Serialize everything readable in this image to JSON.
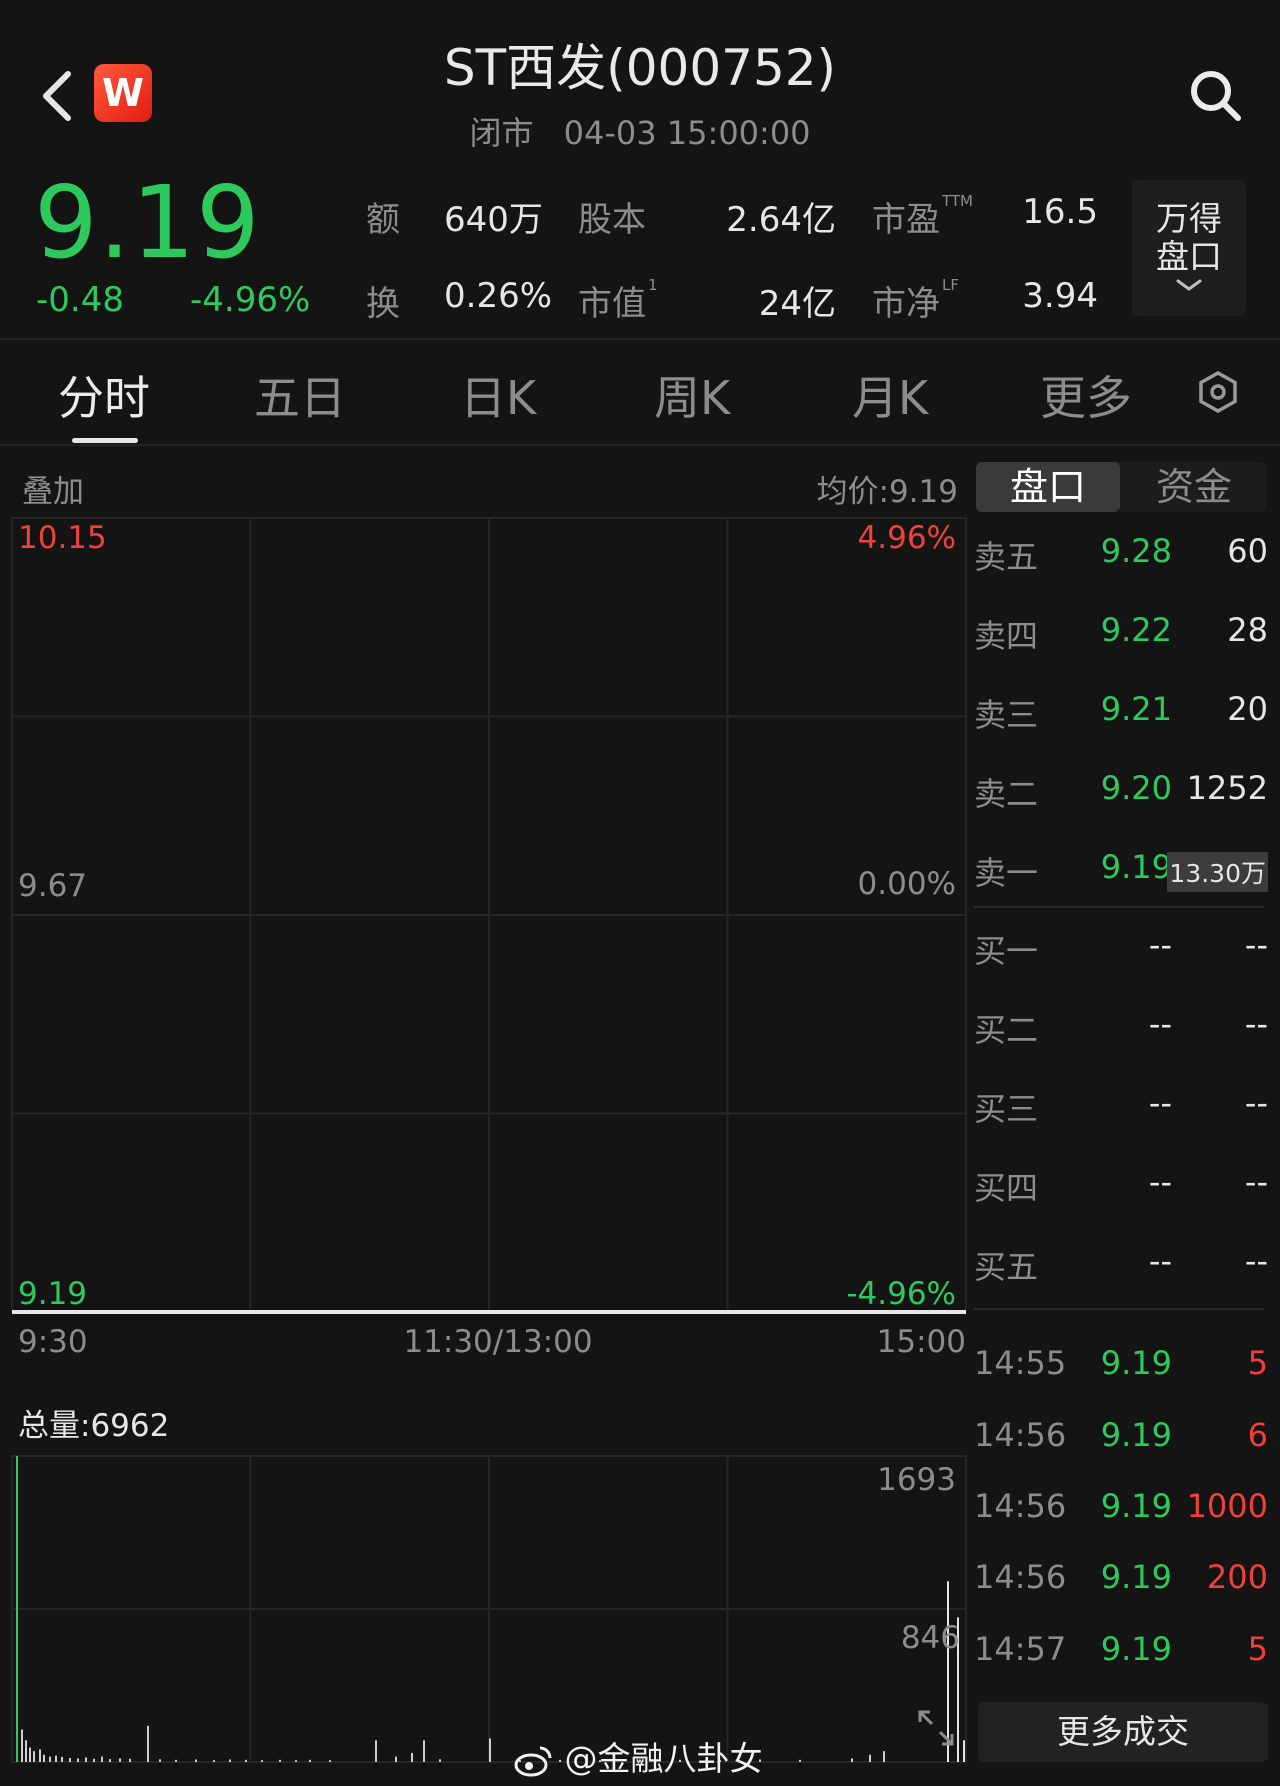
{
  "header": {
    "title": "ST西发(000752)",
    "status": "闭市",
    "datetime": "04-03 15:00:00",
    "logo_text": "W"
  },
  "quote": {
    "price": "9.19",
    "change": "-0.48",
    "change_pct": "-4.96%",
    "stats": [
      {
        "label": "额",
        "value": "640万",
        "sup": ""
      },
      {
        "label": "股本",
        "value": "2.64亿",
        "sup": ""
      },
      {
        "label": "市盈",
        "value": "16.5",
        "sup": "TTM"
      },
      {
        "label": "换",
        "value": "0.26%",
        "sup": ""
      },
      {
        "label": "市值",
        "value": "24亿",
        "sup": "1"
      },
      {
        "label": "市净",
        "value": "3.94",
        "sup": "LF"
      }
    ],
    "wande_button": "万得盘口"
  },
  "tabs": [
    "分时",
    "五日",
    "日K",
    "周K",
    "月K",
    "更多"
  ],
  "active_tab": "分时",
  "chart": {
    "overlay_label": "叠加",
    "avg_price": "均价:9.19",
    "y_top": "10.15",
    "y_mid": "9.67",
    "y_bottom": "9.19",
    "pct_top": "4.96%",
    "pct_mid": "0.00%",
    "pct_bottom": "-4.96%",
    "x_labels": [
      "9:30",
      "11:30/13:00",
      "15:00"
    ],
    "volume_total": "总量:6962",
    "vol_top": "1693",
    "vol_mid": "846",
    "colors": {
      "up": "#f0403c",
      "down": "#2ec95c",
      "price_line": "#e6e6e6",
      "grid": "#262626"
    }
  },
  "order_book": {
    "tabs": [
      "盘口",
      "资金"
    ],
    "active_tab": "盘口",
    "asks": [
      {
        "label": "卖五",
        "price": "9.28",
        "volume": "60"
      },
      {
        "label": "卖四",
        "price": "9.22",
        "volume": "28"
      },
      {
        "label": "卖三",
        "price": "9.21",
        "volume": "20"
      },
      {
        "label": "卖二",
        "price": "9.20",
        "volume": "1252"
      },
      {
        "label": "卖一",
        "price": "9.19",
        "volume": "13.30万"
      }
    ],
    "bids": [
      {
        "label": "买一",
        "price": "--",
        "volume": "--"
      },
      {
        "label": "买二",
        "price": "--",
        "volume": "--"
      },
      {
        "label": "买三",
        "price": "--",
        "volume": "--"
      },
      {
        "label": "买四",
        "price": "--",
        "volume": "--"
      },
      {
        "label": "买五",
        "price": "--",
        "volume": "--"
      }
    ],
    "trades": [
      {
        "time": "14:55",
        "price": "9.19",
        "volume": "5"
      },
      {
        "time": "14:56",
        "price": "9.19",
        "volume": "6"
      },
      {
        "time": "14:56",
        "price": "9.19",
        "volume": "1000"
      },
      {
        "time": "14:56",
        "price": "9.19",
        "volume": "200"
      },
      {
        "time": "14:57",
        "price": "9.19",
        "volume": "5"
      }
    ],
    "more_trades": "更多成交"
  },
  "watermark": "@金融八卦女"
}
